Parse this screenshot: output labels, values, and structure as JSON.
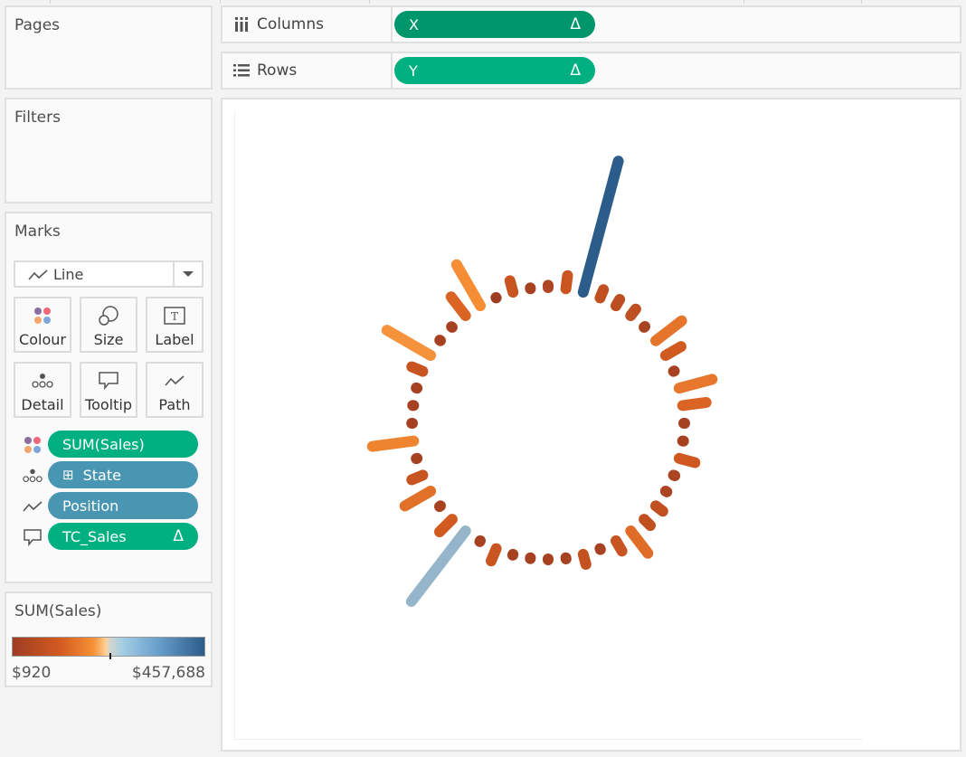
{
  "shelves": {
    "pages": {
      "title": "Pages"
    },
    "filters": {
      "title": "Filters"
    },
    "columns": {
      "label": "Columns",
      "icon": "columns-icon",
      "pill": {
        "label": "X",
        "badge": "Δ",
        "color": "#00966b"
      }
    },
    "rows": {
      "label": "Rows",
      "icon": "rows-icon",
      "pill": {
        "label": "Y",
        "badge": "Δ",
        "color": "#00b080"
      }
    }
  },
  "marks": {
    "title": "Marks",
    "mark_type": {
      "label": "Line",
      "icon": "line-icon"
    },
    "buttons": [
      {
        "label": "Colour",
        "icon": "colour-icon"
      },
      {
        "label": "Size",
        "icon": "size-icon"
      },
      {
        "label": "Label",
        "icon": "label-icon"
      },
      {
        "label": "Detail",
        "icon": "detail-icon"
      },
      {
        "label": "Tooltip",
        "icon": "tooltip-icon"
      },
      {
        "label": "Path",
        "icon": "path-icon"
      }
    ],
    "fields": [
      {
        "label": "SUM(Sales)",
        "encoding": "colour",
        "color": "#00b080",
        "badge": ""
      },
      {
        "label": "State",
        "encoding": "detail",
        "color": "#4996b2",
        "badge": "",
        "expand": "⊞"
      },
      {
        "label": "Position",
        "encoding": "path",
        "color": "#4996b2",
        "badge": ""
      },
      {
        "label": "TC_Sales",
        "encoding": "tooltip",
        "color": "#00b080",
        "badge": "Δ"
      }
    ]
  },
  "legend": {
    "title": "SUM(Sales)",
    "min_label": "$920",
    "max_label": "$457,688",
    "colors": [
      "#9e3d22",
      "#d45b21",
      "#f69035",
      "#d9d5c9",
      "#6ba1cd",
      "#2b5c8a"
    ]
  },
  "chart_data": {
    "type": "radial-line",
    "title": "",
    "description": "Radial bar chart: one line per State arranged around a circle, length and colour by SUM(Sales)",
    "color_field": "SUM(Sales)",
    "color_range": [
      920,
      457688
    ],
    "start_angle_deg": 0,
    "direction": "clockwise",
    "series": [
      {
        "name": "State",
        "values": [
          8000,
          45000,
          457688,
          30000,
          25000,
          28000,
          4000,
          110000,
          60000,
          3000,
          115000,
          80000,
          3000,
          3000,
          55000,
          5000,
          5000,
          30000,
          30000,
          95000,
          40000,
          3500,
          35000,
          4000,
          3000,
          3000,
          3000,
          45000,
          3000,
          300000,
          60000,
          4000,
          100000,
          40000,
          3000,
          140000,
          2500,
          3000,
          3000,
          40000,
          170000,
          3000,
          3000,
          80000,
          160000,
          920,
          40000,
          3000
        ]
      }
    ]
  }
}
